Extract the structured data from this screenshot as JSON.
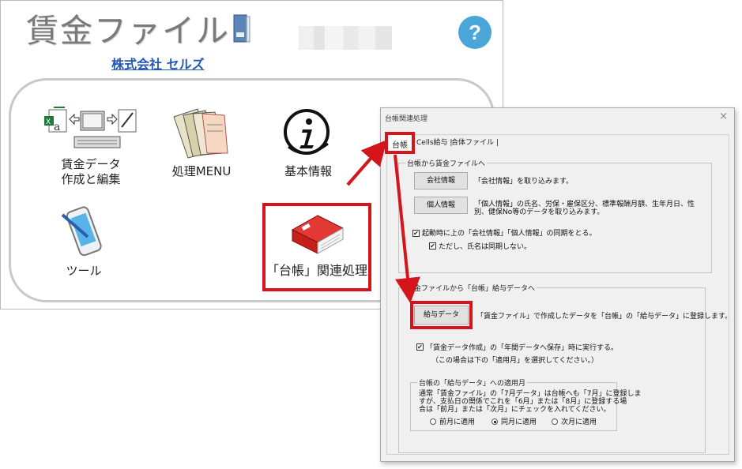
{
  "main_window": {
    "app_title": "賃金ファイル",
    "company_name": "株式会社 セルズ",
    "help_label": "?",
    "menu": {
      "wage_data_line1": "賃金データ",
      "wage_data_line2": "作成と編集",
      "processing_menu": "処理MENU",
      "basic_info": "基本情報",
      "tool": "ツール",
      "ledger_processing": "「台帳」関連処理"
    }
  },
  "dialog": {
    "title": "台帳関連処理",
    "close": "×",
    "tabs": [
      "台帳",
      "Cells給与 |",
      "合体ファイル |"
    ],
    "group1": {
      "title": "台帳から賃金ファイルへ",
      "company_button": "会社情報",
      "company_desc": "「会社情報」を取り込みます。",
      "personal_button": "個人情報",
      "personal_desc_line1": "「個人情報」の氏名、労保・雇保区分、標準報酬月額、生年月日、性",
      "personal_desc_line2": "別、健保No等のデータを取り込みます。",
      "sync_label": "起動時に上の「会社情報」「個人情報」の同期をとる。",
      "sync_checked": true,
      "name_label": "ただし、氏名は同期しない。",
      "name_checked": true
    },
    "group2": {
      "title": "賃金ファイルから「台帳」給与データへ",
      "salary_button": "給与データ",
      "salary_desc": "「賃金ファイル」で作成したデータを「台帳」の「給与データ」に登録します。",
      "auto_label": "「賃金データ作成」の「年間データへ保存」時に実行する。",
      "auto_checked": true,
      "auto_note": "（この場合は下の「適用月」を選択してください。）"
    },
    "group3": {
      "title": "台帳の「給与データ」への適用月",
      "desc_line1": "通常「賃金ファイル」の「7月データ」は台帳へも「7月」に登録しま",
      "desc_line2": "すが、支払日の関係でこれを「6月」または「8月」に登録する場",
      "desc_line3": "合は「前月」または「次月」にチェックを入れてください。",
      "options": [
        "前月に適用",
        "同月に適用",
        "次月に適用"
      ],
      "selected": "同月に適用"
    }
  },
  "colors": {
    "highlight": "#d4151c",
    "link": "#2458b8",
    "help": "#4aa6d8"
  }
}
